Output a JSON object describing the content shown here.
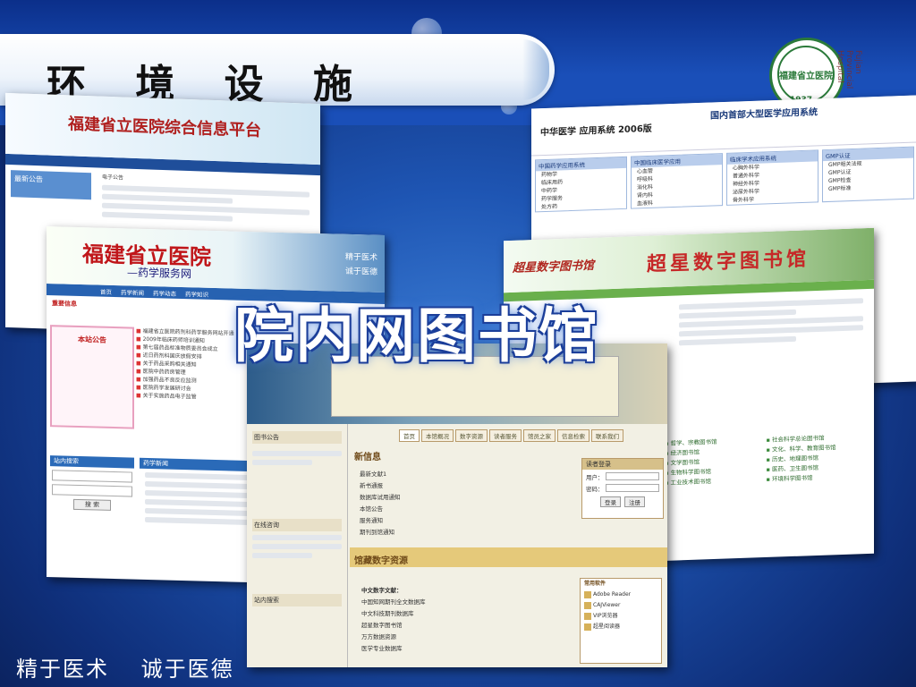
{
  "slide": {
    "title": "环 境 设 施",
    "overlay_text": "院内网图书馆",
    "footer_motto": "精于医术　  诚于医德",
    "colors": {
      "background": "#1e55b3",
      "title_band": "#ffffff",
      "overlay_outline": "#1c3f9a"
    }
  },
  "logo": {
    "text": "福建省立医院",
    "year": "1937",
    "side_text": "Fujian Provincial Hospital"
  },
  "screenshot1": {
    "title": "福建省立医院综合信息平台",
    "latest_notice": "最新公告",
    "menu_label": "电子公告"
  },
  "screenshot2": {
    "title": "福建省立医院",
    "subtitle": "—药学服务网",
    "slogan1": "精于医术",
    "slogan2": "诚于医德",
    "nav": [
      "首页",
      "药学新闻",
      "药学动态",
      "药学知识"
    ],
    "focus_label": "重要信息",
    "notice_header": "本站公告",
    "items": [
      "福建省立医院药剂科药学服务网站开通",
      "2009年临床药师培训通知",
      "第七届药品标准物质委员会成立",
      "近日药剂科国庆放假安排",
      "关于药品采购相关通知",
      "医院中药药房管理",
      "加强药品不良反应监测",
      "医院药学发展研讨会",
      "关于实施药品电子监管"
    ],
    "search_box": "站内搜索",
    "search_button": "搜 索",
    "news_box": "药学新闻"
  },
  "screenshot3": {
    "logo_text": "中华医学 应用系统 2006版",
    "heading": "国内首部大型医学应用系统",
    "columns": [
      {
        "head": "中国药学应用系统",
        "items": [
          "药物学",
          "临床用药",
          "中药学",
          "药学服务",
          "处方药"
        ]
      },
      {
        "head": "中国临床医学应用",
        "items": [
          "心血管",
          "呼吸科",
          "消化科",
          "肾内科",
          "血液科"
        ]
      },
      {
        "head": "临床学术应用系统",
        "items": [
          "心胸外科学",
          "普通外科学",
          "神经外科学",
          "泌尿外科学",
          "骨外科学"
        ]
      },
      {
        "head": "GMP认证",
        "items": [
          "GMP相关法规",
          "GMP认证",
          "GMP检查",
          "GMP标准"
        ]
      }
    ]
  },
  "screenshot4": {
    "logo_text": "超星数字图书馆",
    "heading": "超星数字图书馆",
    "links": [
      "哲学、宗教图书馆",
      "经济图书馆",
      "文学图书馆",
      "生物科学图书馆",
      "工业技术图书馆",
      "社会科学总论图书馆",
      "文化、科学、教育图书馆",
      "历史、地理图书馆",
      "医药、卫生图书馆",
      "环境科学图书馆"
    ]
  },
  "screenshot5": {
    "nav": [
      "首页",
      "本馆概况",
      "数字资源",
      "读者服务",
      "馆员之家",
      "信息检索",
      "联系我们"
    ],
    "news_heading": "新信息",
    "news": [
      "最新文献1",
      "新书通报",
      "数据库试用通知",
      "本馆公告",
      "服务通知",
      "期刊到馆通知"
    ],
    "login_title": "读者登录",
    "login_user": "用户：",
    "login_pwd": "密码：",
    "login_btn": "登录",
    "reg_btn": "注册",
    "sidebar_notice": "图书公告",
    "sidebar_consult": "在线咨询",
    "sidebar_search": "站内搜索",
    "resource_heading": "馆藏数字资源",
    "chinese_db": "中文数字文献：",
    "chinese_items": [
      "中国知网期刊全文数据库",
      "中文科技期刊数据库",
      "超星数字图书馆",
      "万方数据资源",
      "医学专业数据库"
    ],
    "right_title": "常用软件",
    "right_items": [
      "Adobe Reader",
      "CAJViewer",
      "VIP浏览器",
      "超星阅读器"
    ]
  }
}
